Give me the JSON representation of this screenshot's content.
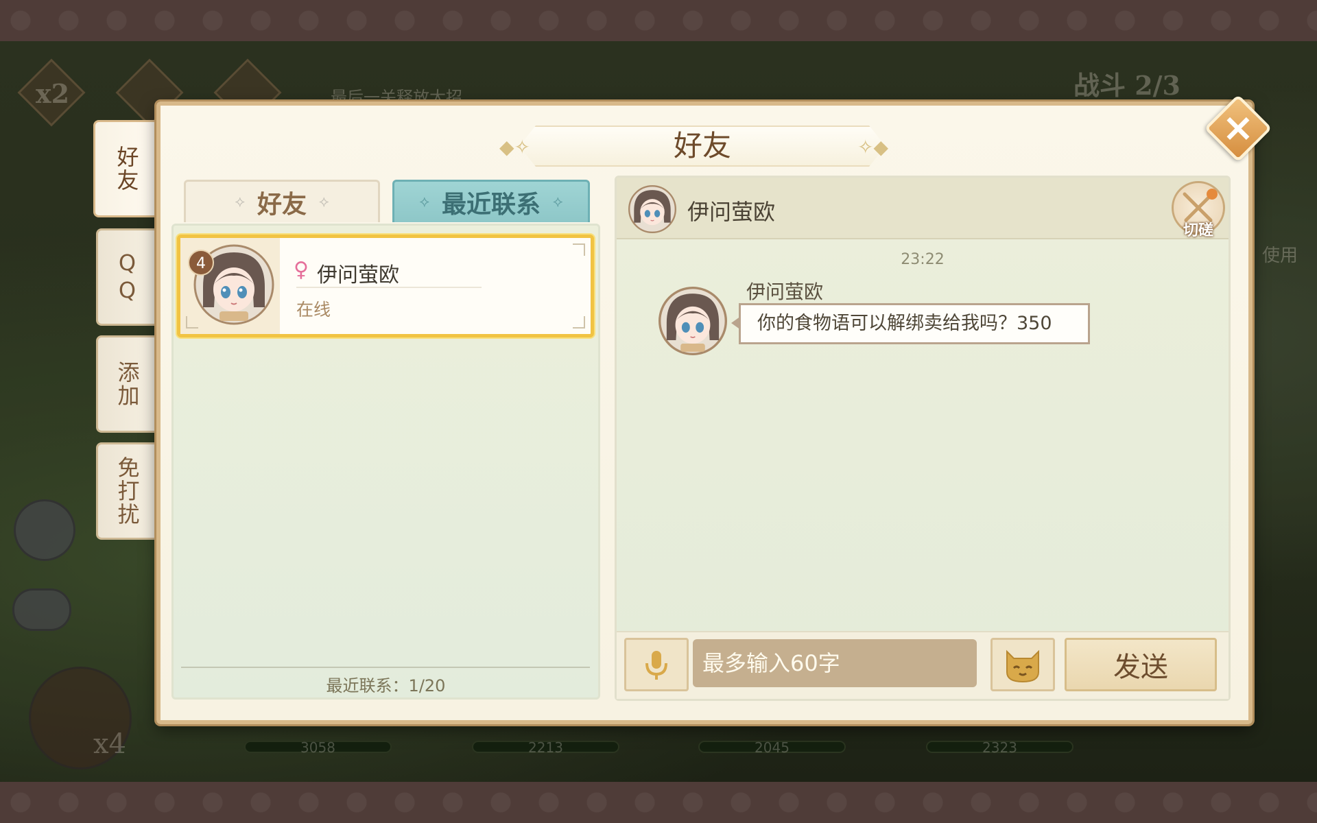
{
  "background": {
    "speed_label": "x2",
    "hint_text": "最后一关释放大招",
    "battle_label": "战斗 2/3",
    "side_text": "使用",
    "bottom_count": "x4",
    "hp_values": [
      "3058",
      "2213",
      "2045",
      "2323"
    ]
  },
  "dialog": {
    "title": "好友"
  },
  "side_tabs": [
    {
      "label": "好友",
      "active": true
    },
    {
      "label": "QQ",
      "active": false
    },
    {
      "label": "添加",
      "active": false
    },
    {
      "label": "免打扰",
      "active": false
    }
  ],
  "sub_tabs": {
    "friends": "好友",
    "recent": "最近联系"
  },
  "contacts": [
    {
      "name": "伊问萤欧",
      "status": "在线",
      "unread": "4",
      "gender_symbol": "♀"
    }
  ],
  "list_footer": "最近联系：1/20",
  "chat": {
    "partner_name": "伊问萤欧",
    "duel_label": "切磋",
    "timestamp": "23:22",
    "messages": [
      {
        "sender": "伊问萤欧",
        "text": "你的食物语可以解绑卖给我吗？350"
      }
    ],
    "input_placeholder": "最多输入60字",
    "send_label": "发送"
  },
  "colors": {
    "accent_gold": "#f1c343",
    "active_tab_teal": "#8ec7c8",
    "panel_bg": "#fbf7ea"
  }
}
